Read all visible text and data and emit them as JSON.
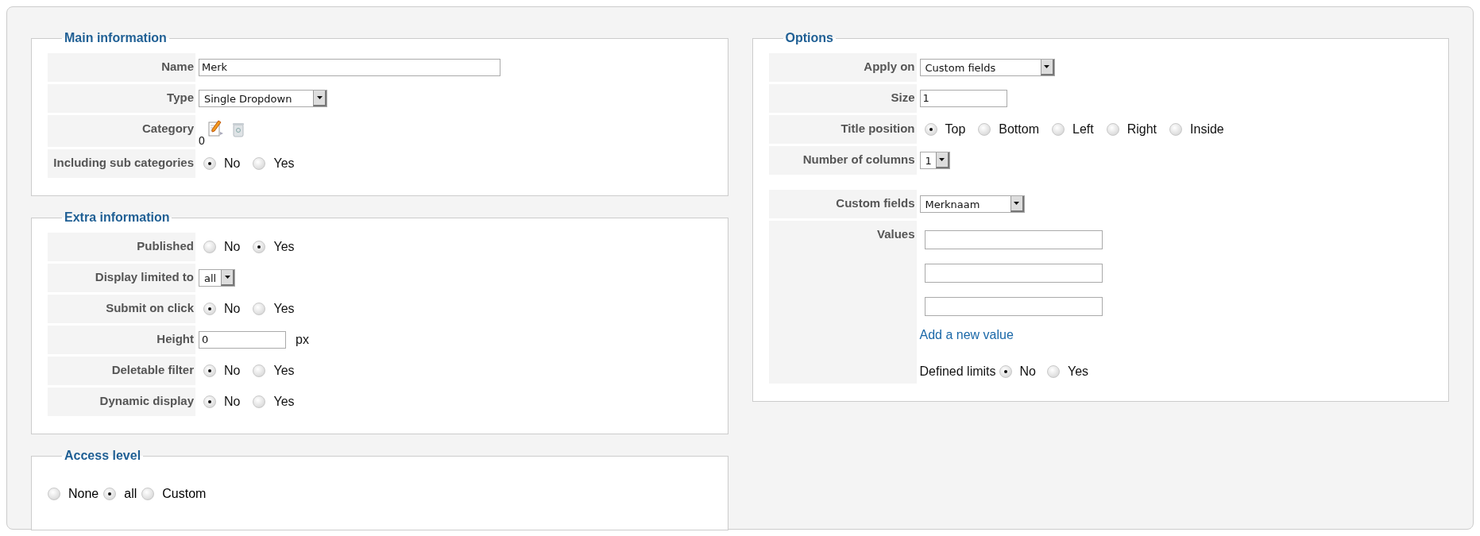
{
  "main_information": {
    "legend": "Main information",
    "rows": [
      {
        "kind": "text",
        "label": "Name",
        "value": "Merk"
      },
      {
        "kind": "select",
        "label": "Type",
        "value": "Single Dropdown"
      },
      {
        "kind": "category",
        "label": "Category",
        "value": "0"
      },
      {
        "kind": "radio",
        "label": "Including sub categories",
        "options": [
          {
            "label": "No",
            "selected": true
          },
          {
            "label": "Yes",
            "selected": false
          }
        ]
      }
    ]
  },
  "extra_information": {
    "legend": "Extra information",
    "rows": [
      {
        "kind": "radio",
        "label": "Published",
        "options": [
          {
            "label": "No",
            "selected": false
          },
          {
            "label": "Yes",
            "selected": true
          }
        ]
      },
      {
        "kind": "select",
        "label": "Display limited to",
        "value": "all"
      },
      {
        "kind": "radio",
        "label": "Submit on click",
        "options": [
          {
            "label": "No",
            "selected": true
          },
          {
            "label": "Yes",
            "selected": false
          }
        ]
      },
      {
        "kind": "text",
        "label": "Height",
        "value": "0",
        "suffix": "px"
      },
      {
        "kind": "radio",
        "label": "Deletable filter",
        "options": [
          {
            "label": "No",
            "selected": true
          },
          {
            "label": "Yes",
            "selected": false
          }
        ]
      },
      {
        "kind": "radio",
        "label": "Dynamic display",
        "options": [
          {
            "label": "No",
            "selected": true
          },
          {
            "label": "Yes",
            "selected": false
          }
        ]
      }
    ]
  },
  "access_level": {
    "legend": "Access level",
    "options": [
      {
        "label": "None",
        "selected": false
      },
      {
        "label": "all",
        "selected": true
      },
      {
        "label": "Custom",
        "selected": false
      }
    ]
  },
  "options": {
    "legend": "Options",
    "rows": [
      {
        "kind": "select",
        "label": "Apply on",
        "value": "Custom fields"
      },
      {
        "kind": "text",
        "label": "Size",
        "value": "1"
      },
      {
        "kind": "radio",
        "label": "Title position",
        "options": [
          {
            "label": "Top",
            "selected": true
          },
          {
            "label": "Bottom",
            "selected": false
          },
          {
            "label": "Left",
            "selected": false
          },
          {
            "label": "Right",
            "selected": false
          },
          {
            "label": "Inside",
            "selected": false
          }
        ]
      },
      {
        "kind": "select",
        "label": "Number of columns",
        "value": "1"
      }
    ],
    "custom_rows": [
      {
        "kind": "select",
        "label": "Custom fields",
        "value": "Merknaam"
      },
      {
        "kind": "values",
        "label": "Values",
        "fields": [
          {
            "kind": "text"
          },
          {
            "kind": "text"
          },
          {
            "kind": "text"
          }
        ],
        "link": "Add a new value",
        "defined_limits": {
          "label": "Defined limits",
          "options": [
            {
              "label": "No",
              "selected": true
            },
            {
              "label": "Yes",
              "selected": false
            }
          ]
        }
      }
    ]
  }
}
